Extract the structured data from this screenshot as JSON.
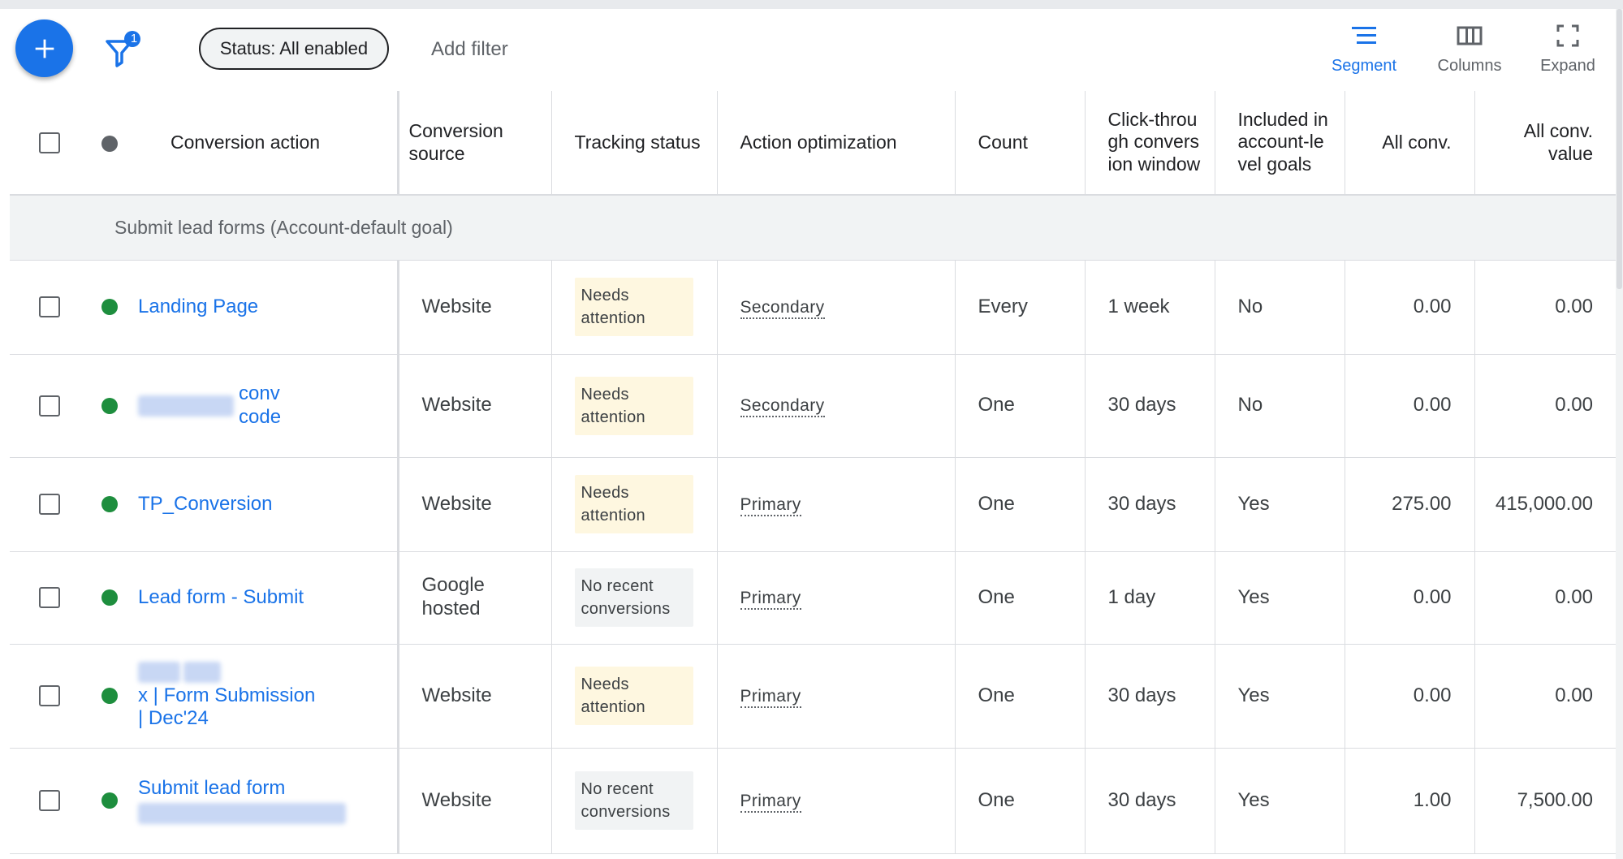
{
  "toolbar": {
    "add_icon": "plus-icon",
    "filter_icon": "filter-icon",
    "filter_badge": "1",
    "status_chip": "Status: All enabled",
    "add_filter": "Add filter",
    "tools": [
      {
        "label": "Segment",
        "icon": "segment-icon",
        "active": true
      },
      {
        "label": "Columns",
        "icon": "columns-icon",
        "active": false
      },
      {
        "label": "Expand",
        "icon": "expand-icon",
        "active": false
      }
    ]
  },
  "table": {
    "headers": {
      "conversion_action": "Conversion action",
      "conversion_source": "Conversion source",
      "tracking_status": "Tracking status",
      "action_optimization": "Action optimization",
      "count": "Count",
      "click_through_window": "Click-through conversion window",
      "included_goals": "Included in account-level goals",
      "all_conv": "All conv.",
      "all_conv_value": "All conv. value"
    },
    "group_label": "Submit lead forms (Account-default goal)",
    "rows": [
      {
        "action_text": "Landing Page",
        "source": "Website",
        "status": "Needs attention",
        "optimization": "Secondary",
        "count": "Every",
        "window": "1 week",
        "included": "No",
        "all_conv": "0.00",
        "all_conv_value": "0.00"
      },
      {
        "action_text": "conv code",
        "source": "Website",
        "status": "Needs attention",
        "optimization": "Secondary",
        "count": "One",
        "window": "30 days",
        "included": "No",
        "all_conv": "0.00",
        "all_conv_value": "0.00"
      },
      {
        "action_text": "TP_Conversion",
        "source": "Website",
        "status": "Needs attention",
        "optimization": "Primary",
        "count": "One",
        "window": "30 days",
        "included": "Yes",
        "all_conv": "275.00",
        "all_conv_value": "415,000.00"
      },
      {
        "action_text": "Lead form - Submit",
        "source": "Google hosted",
        "status": "No recent conversions",
        "optimization": "Primary",
        "count": "One",
        "window": "1 day",
        "included": "Yes",
        "all_conv": "0.00",
        "all_conv_value": "0.00"
      },
      {
        "action_text": "x | Form Submission | Dec'24",
        "source": "Website",
        "status": "Needs attention",
        "optimization": "Primary",
        "count": "One",
        "window": "30 days",
        "included": "Yes",
        "all_conv": "0.00",
        "all_conv_value": "0.00"
      },
      {
        "action_text": "Submit lead form",
        "source": "Website",
        "status": "No recent conversions",
        "optimization": "Primary",
        "count": "One",
        "window": "30 days",
        "included": "Yes",
        "all_conv": "1.00",
        "all_conv_value": "7,500.00"
      }
    ]
  },
  "colors": {
    "accent": "#1a73e8",
    "enabled_dot": "#1e8e3e",
    "needs_attention_bg": "#fef7e0",
    "no_recent_bg": "#f1f3f4"
  }
}
